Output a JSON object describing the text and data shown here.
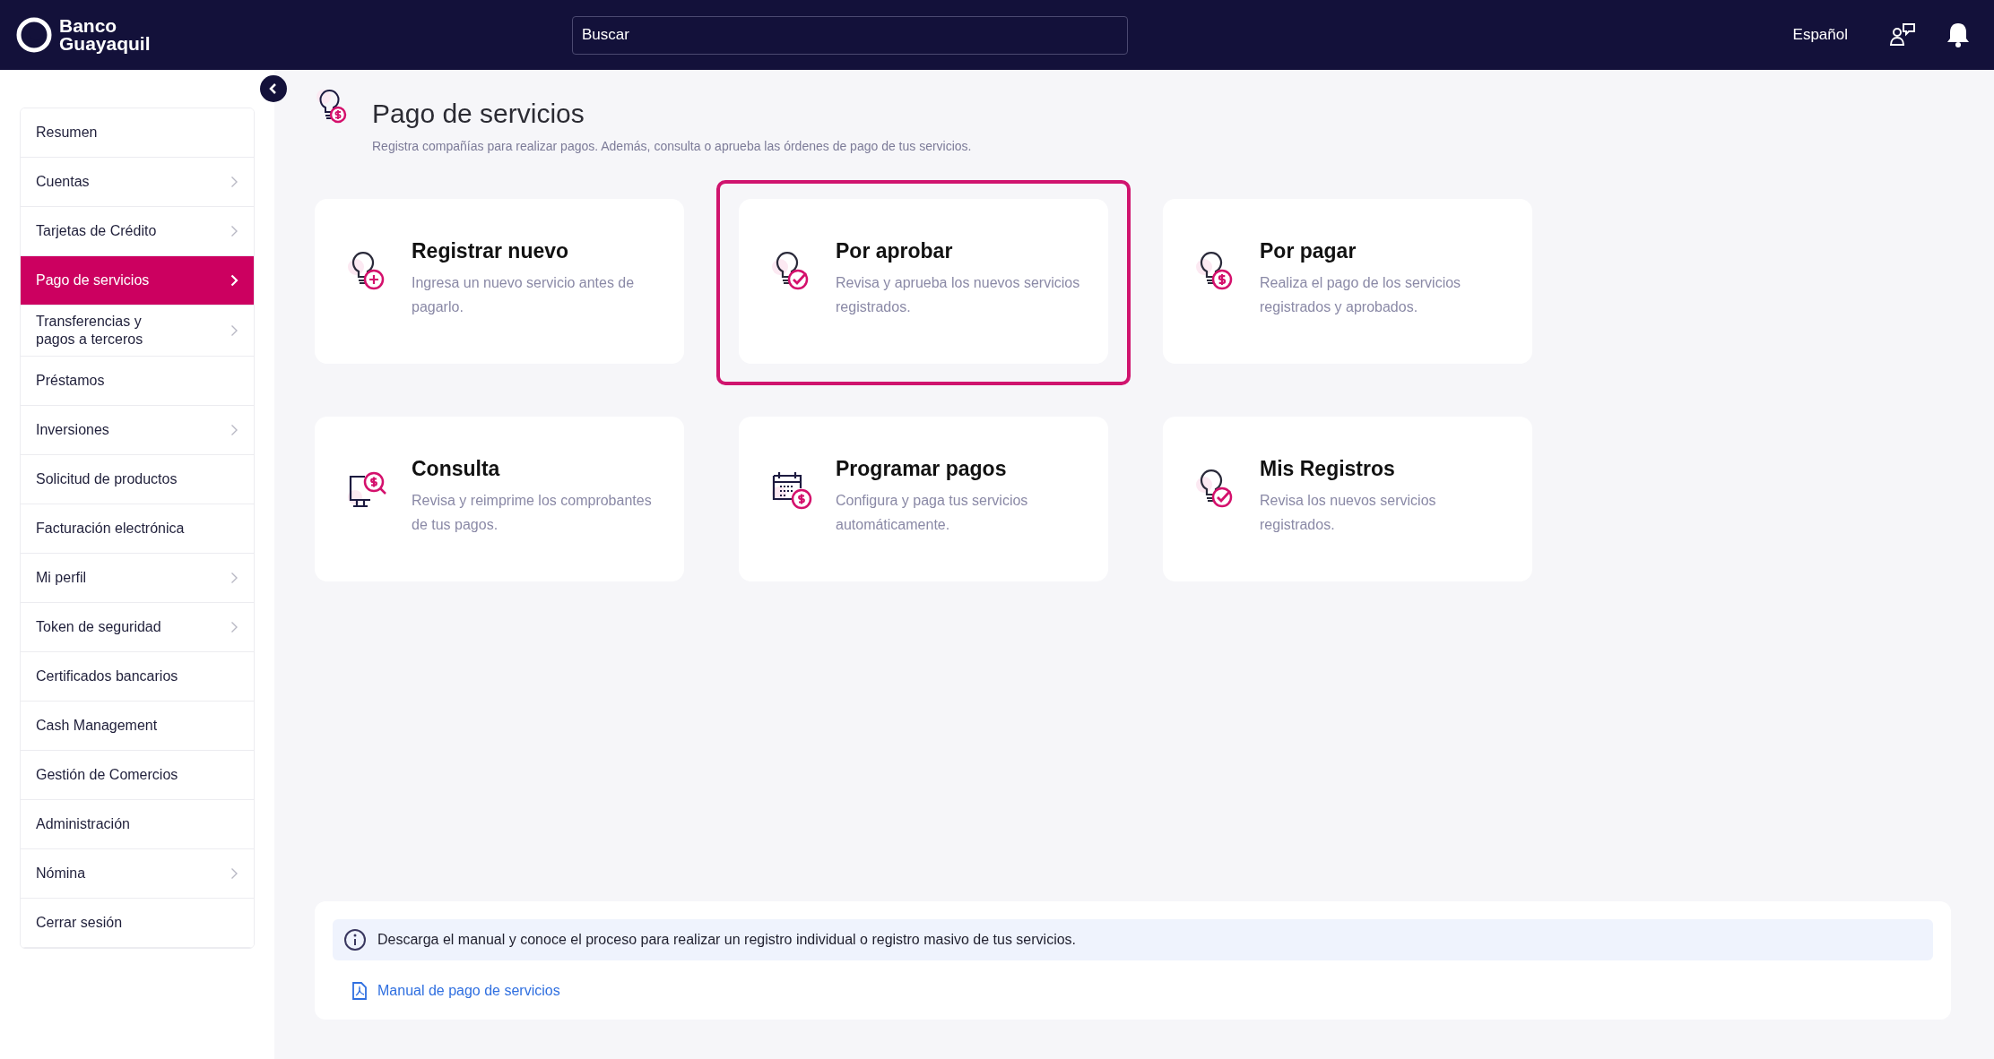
{
  "header": {
    "brand": "Banco\nGuayaquil",
    "search": {
      "placeholder": "Buscar"
    },
    "language": "Español"
  },
  "sidebar": {
    "items": [
      {
        "label": "Resumen",
        "has_submenu": false,
        "selected": false
      },
      {
        "label": "Cuentas",
        "has_submenu": true,
        "selected": false
      },
      {
        "label": "Tarjetas de Crédito",
        "has_submenu": true,
        "selected": false
      },
      {
        "label": "Pago de servicios",
        "has_submenu": true,
        "selected": true
      },
      {
        "label": "Transferencias y\npagos a terceros",
        "has_submenu": true,
        "selected": false
      },
      {
        "label": "Préstamos",
        "has_submenu": false,
        "selected": false
      },
      {
        "label": "Inversiones",
        "has_submenu": true,
        "selected": false
      },
      {
        "label": "Solicitud de productos",
        "has_submenu": false,
        "selected": false
      },
      {
        "label": "Facturación electrónica",
        "has_submenu": false,
        "selected": false
      },
      {
        "label": "Mi perfil",
        "has_submenu": true,
        "selected": false
      },
      {
        "label": "Token de seguridad",
        "has_submenu": true,
        "selected": false
      },
      {
        "label": "Certificados bancarios",
        "has_submenu": false,
        "selected": false
      },
      {
        "label": "Cash Management",
        "has_submenu": false,
        "selected": false
      },
      {
        "label": "Gestión de Comercios",
        "has_submenu": false,
        "selected": false
      },
      {
        "label": "Administración",
        "has_submenu": false,
        "selected": false
      },
      {
        "label": "Nómina",
        "has_submenu": true,
        "selected": false
      },
      {
        "label": "Cerrar sesión",
        "has_submenu": false,
        "selected": false
      }
    ]
  },
  "page": {
    "title": "Pago de servicios",
    "subtitle": "Registra compañías para realizar pagos. Además, consulta o aprueba las órdenes de pago de tus servicios."
  },
  "cards": [
    {
      "kind": "bulb-plus",
      "title": "Registrar nuevo",
      "description": "Ingresa un nuevo servicio antes de pagarlo.",
      "highlighted": false
    },
    {
      "kind": "bulb-check",
      "title": "Por aprobar",
      "description": "Revisa y aprueba los nuevos servicios registrados.",
      "highlighted": true
    },
    {
      "kind": "bulb-dollar",
      "title": "Por pagar",
      "description": "Realiza el pago de los servicios registrados y aprobados.",
      "highlighted": false
    },
    {
      "kind": "monitor-search",
      "title": "Consulta",
      "description": "Revisa y reimprime los comprobantes de tus pagos.",
      "highlighted": false
    },
    {
      "kind": "calendar-dollar",
      "title": "Programar pagos",
      "description": "Configura y paga tus servicios automáticamente.",
      "highlighted": false
    },
    {
      "kind": "bulb-check",
      "title": "Mis Registros",
      "description": "Revisa los nuevos servicios registrados.",
      "highlighted": false
    }
  ],
  "info": {
    "message": "Descarga el manual y conoce el proceso para realizar un registro individual o registro masivo de tus servicios.",
    "link": "Manual de pago de servicios"
  }
}
